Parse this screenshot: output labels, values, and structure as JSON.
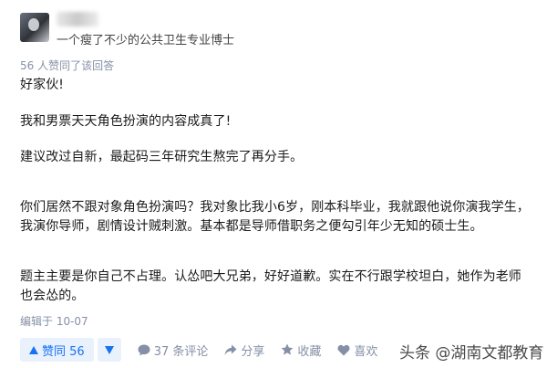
{
  "author": {
    "headline": "一个瘦了不少的公共卫生专业博士"
  },
  "upvote_note": "56 人赞同了该回答",
  "answer": {
    "paragraphs": [
      "好家伙!",
      "我和男票天天角色扮演的内容成真了!",
      "建议改过自新，最起码三年研究生熬完了再分手。",
      "你们居然不跟对象角色扮演吗？我对象比我小6岁，刚本科毕业，我就跟他说你演我学生，我演你导师，剧情设计贼刺激。基本都是导师借职务之便勾引年少无知的硕士生。",
      "题主主要是你自己不占理。认怂吧大兄弟，好好道歉。实在不行跟学校坦白，她作为老师也会怂的。"
    ],
    "edited": "编辑于 10-07"
  },
  "actions": {
    "upvote_label": "赞同 56",
    "comments_label": "37 条评论",
    "share_label": "分享",
    "favorite_label": "收藏",
    "like_label": "喜欢"
  },
  "watermark": "头条 @湖南文都教育",
  "colors": {
    "accent": "#1772f6",
    "accent_bg": "#e9f1fd",
    "muted": "#8590a6"
  }
}
